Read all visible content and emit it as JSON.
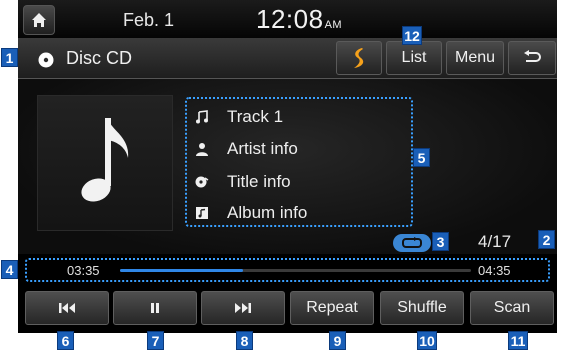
{
  "status": {
    "date": "Feb.  1",
    "time": "12:08",
    "ampm": "AM"
  },
  "title": {
    "source": "Disc CD",
    "list": "List",
    "menu": "Menu"
  },
  "track": {
    "name": "Track 1",
    "artist": "Artist info",
    "title": "Title info",
    "album": "Album info",
    "count": "4/17"
  },
  "progress": {
    "elapsed": "03:35",
    "total": "04:35",
    "fraction": 0.35
  },
  "controls": {
    "repeat": "Repeat",
    "shuffle": "Shuffle",
    "scan": "Scan"
  },
  "callouts": [
    "1",
    "2",
    "3",
    "4",
    "5",
    "6",
    "7",
    "8",
    "9",
    "10",
    "11",
    "12"
  ],
  "colors": {
    "accent": "#2f86e6",
    "callout": "#1a5fb8",
    "highlight_dotted": "#3aa0ff"
  }
}
